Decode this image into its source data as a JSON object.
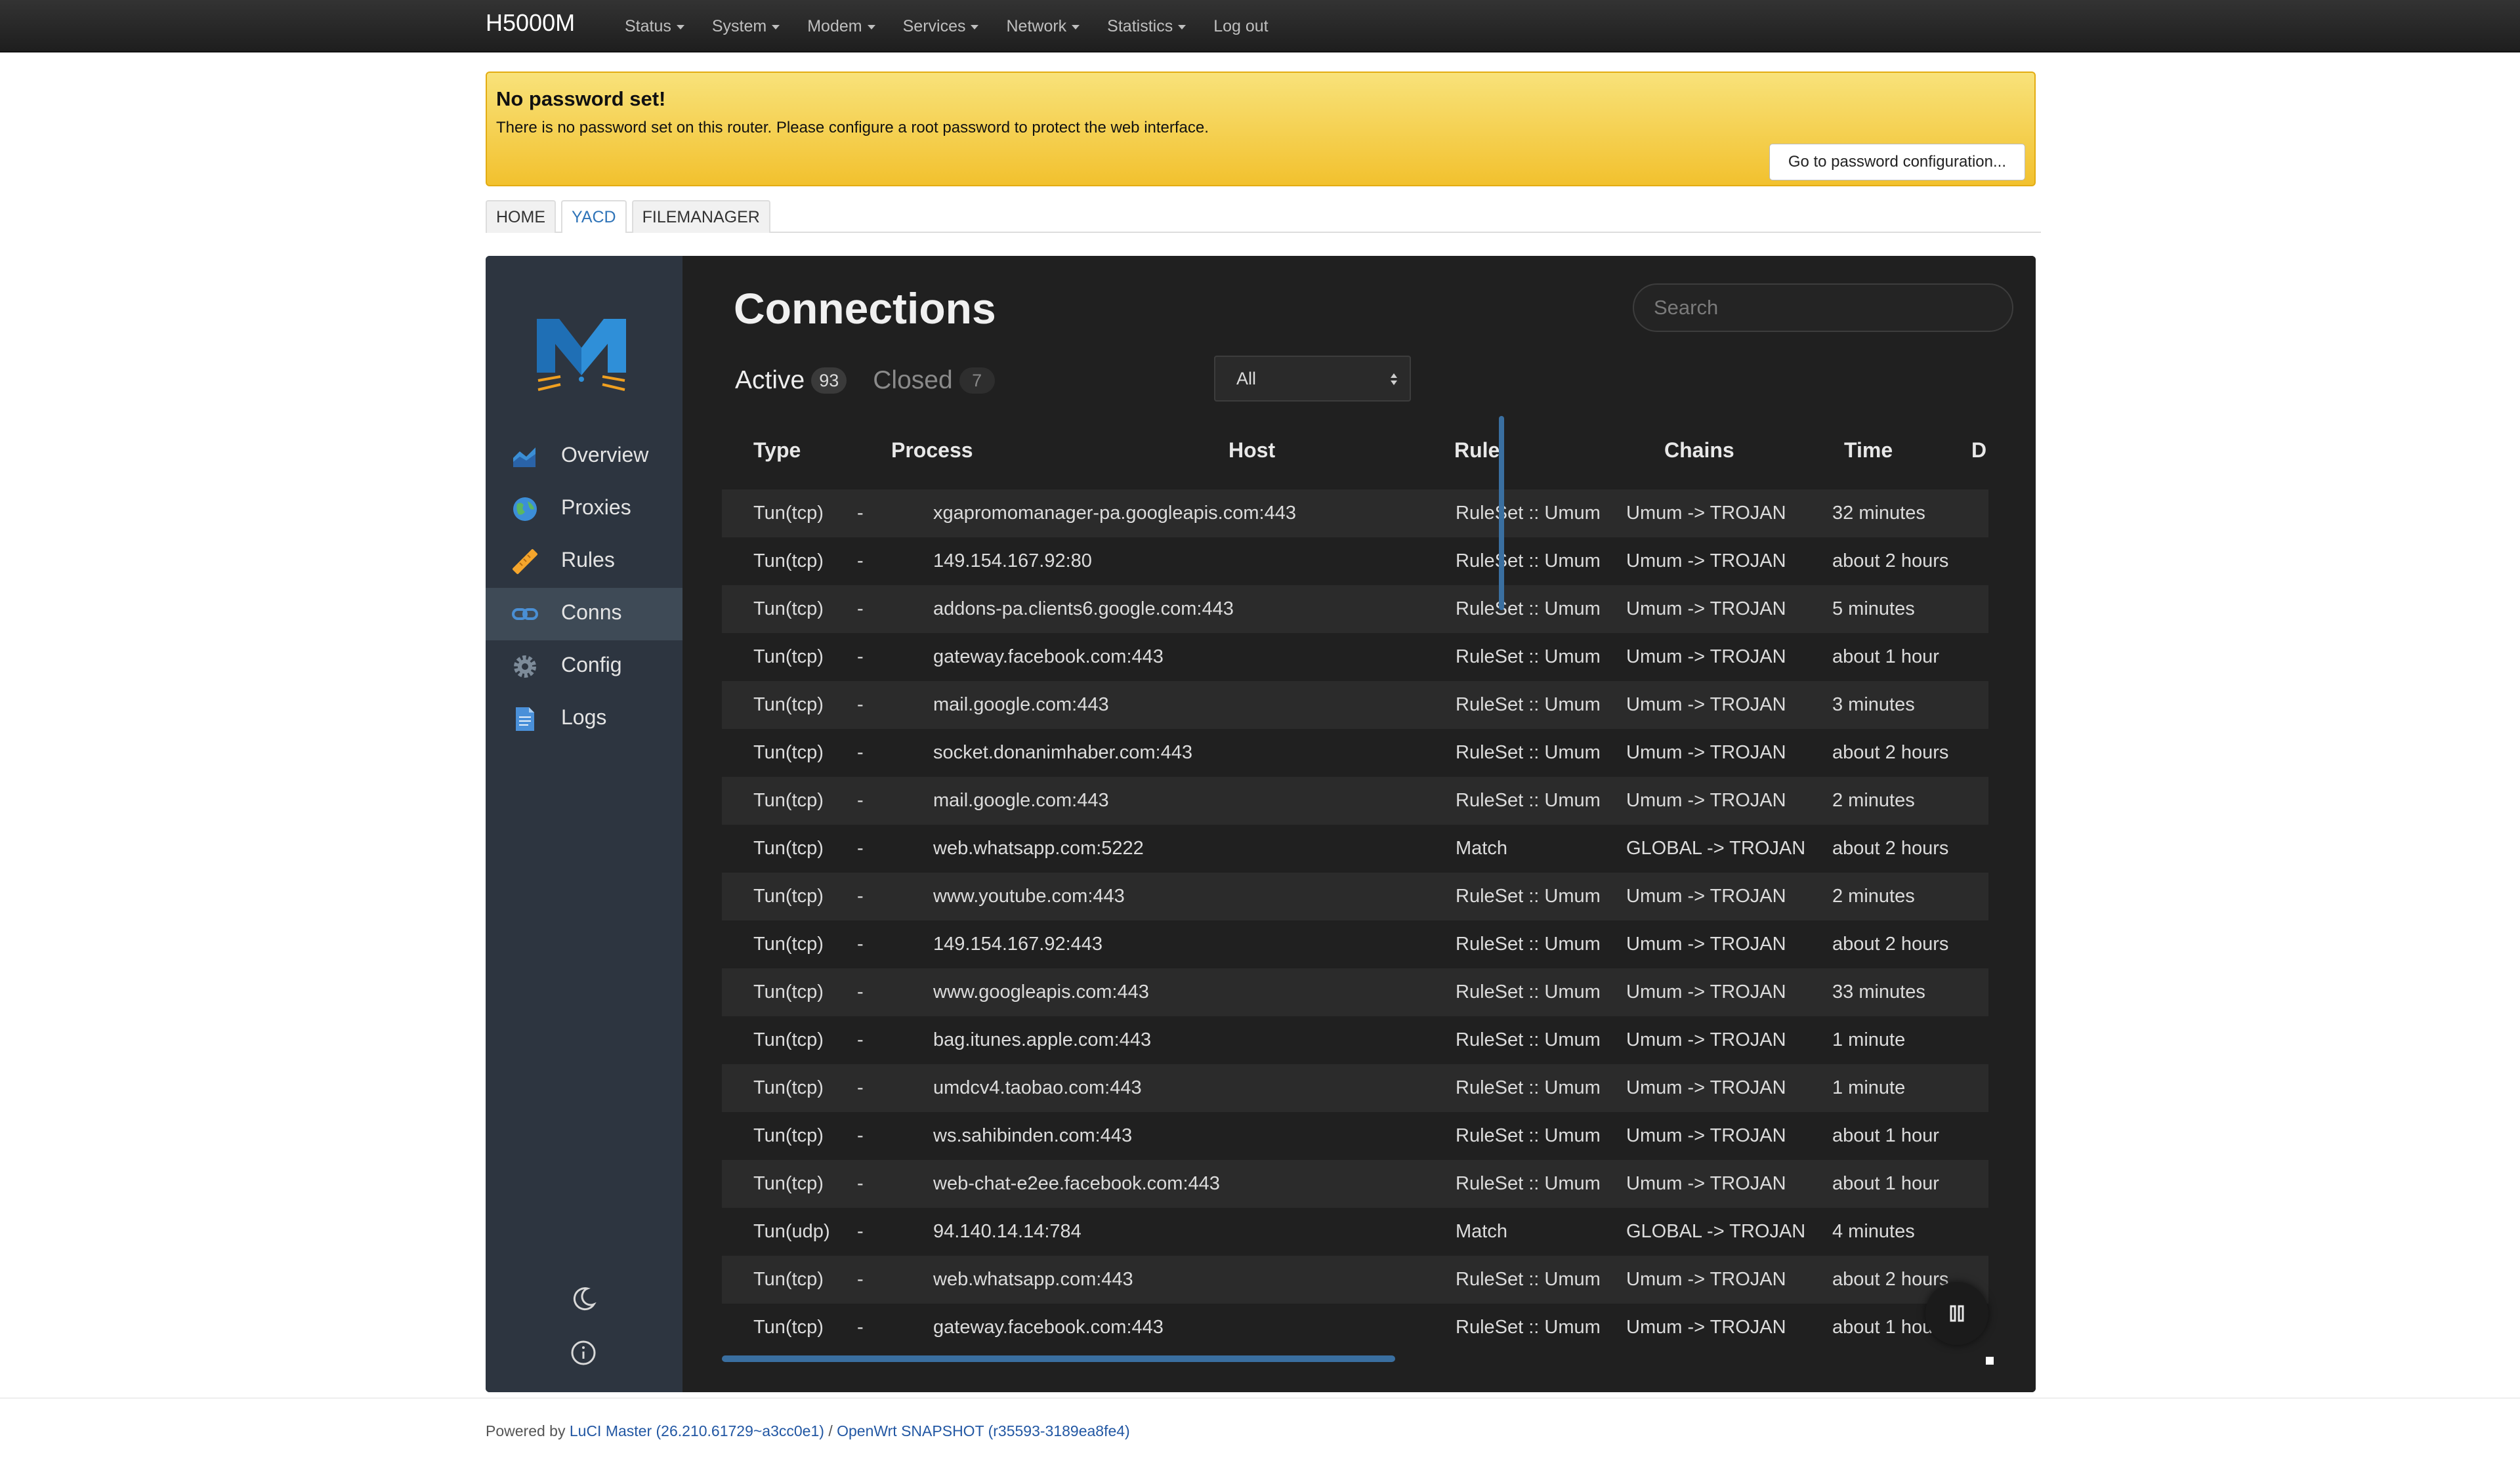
{
  "topbar": {
    "brand": "H5000M",
    "menu": [
      "Status",
      "System",
      "Modem",
      "Services",
      "Network",
      "Statistics"
    ],
    "logout": "Log out"
  },
  "alert": {
    "title": "No password set!",
    "text": "There is no password set on this router. Please configure a root password to protect the web interface.",
    "button": "Go to password configuration..."
  },
  "luci_tabs": [
    {
      "label": "HOME",
      "active": false
    },
    {
      "label": "YACD",
      "active": true
    },
    {
      "label": "FILEMANAGER",
      "active": false
    }
  ],
  "sidebar": {
    "items": [
      {
        "label": "Overview",
        "icon": "overview-chart-icon",
        "active": false
      },
      {
        "label": "Proxies",
        "icon": "globe-icon",
        "active": false
      },
      {
        "label": "Rules",
        "icon": "ruler-icon",
        "active": false
      },
      {
        "label": "Conns",
        "icon": "link-icon",
        "active": true
      },
      {
        "label": "Config",
        "icon": "gear-icon",
        "active": false
      },
      {
        "label": "Logs",
        "icon": "document-icon",
        "active": false
      }
    ],
    "bottom_icons": [
      "moon-icon",
      "info-icon"
    ]
  },
  "main": {
    "title": "Connections",
    "search_placeholder": "Search",
    "tabs": [
      {
        "label": "Active",
        "count": "93"
      },
      {
        "label": "Closed",
        "count": "7"
      }
    ],
    "filter_value": "All"
  },
  "table": {
    "headers": [
      "Type",
      "Process",
      "Host",
      "Rule",
      "Chains",
      "Time",
      "D"
    ],
    "rows": [
      [
        "Tun(tcp)",
        "-",
        "xgapromomanager-pa.googleapis.com:443",
        "RuleSet :: Umum",
        "Umum -> TROJAN",
        "32 minutes"
      ],
      [
        "Tun(tcp)",
        "-",
        "149.154.167.92:80",
        "RuleSet :: Umum",
        "Umum -> TROJAN",
        "about 2 hours"
      ],
      [
        "Tun(tcp)",
        "-",
        "addons-pa.clients6.google.com:443",
        "RuleSet :: Umum",
        "Umum -> TROJAN",
        "5 minutes"
      ],
      [
        "Tun(tcp)",
        "-",
        "gateway.facebook.com:443",
        "RuleSet :: Umum",
        "Umum -> TROJAN",
        "about 1 hour"
      ],
      [
        "Tun(tcp)",
        "-",
        "mail.google.com:443",
        "RuleSet :: Umum",
        "Umum -> TROJAN",
        "3 minutes"
      ],
      [
        "Tun(tcp)",
        "-",
        "socket.donanimhaber.com:443",
        "RuleSet :: Umum",
        "Umum -> TROJAN",
        "about 2 hours"
      ],
      [
        "Tun(tcp)",
        "-",
        "mail.google.com:443",
        "RuleSet :: Umum",
        "Umum -> TROJAN",
        "2 minutes"
      ],
      [
        "Tun(tcp)",
        "-",
        "web.whatsapp.com:5222",
        "Match",
        "GLOBAL -> TROJAN",
        "about 2 hours"
      ],
      [
        "Tun(tcp)",
        "-",
        "www.youtube.com:443",
        "RuleSet :: Umum",
        "Umum -> TROJAN",
        "2 minutes"
      ],
      [
        "Tun(tcp)",
        "-",
        "149.154.167.92:443",
        "RuleSet :: Umum",
        "Umum -> TROJAN",
        "about 2 hours"
      ],
      [
        "Tun(tcp)",
        "-",
        "www.googleapis.com:443",
        "RuleSet :: Umum",
        "Umum -> TROJAN",
        "33 minutes"
      ],
      [
        "Tun(tcp)",
        "-",
        "bag.itunes.apple.com:443",
        "RuleSet :: Umum",
        "Umum -> TROJAN",
        "1 minute"
      ],
      [
        "Tun(tcp)",
        "-",
        "umdcv4.taobao.com:443",
        "RuleSet :: Umum",
        "Umum -> TROJAN",
        "1 minute"
      ],
      [
        "Tun(tcp)",
        "-",
        "ws.sahibinden.com:443",
        "RuleSet :: Umum",
        "Umum -> TROJAN",
        "about 1 hour"
      ],
      [
        "Tun(tcp)",
        "-",
        "web-chat-e2ee.facebook.com:443",
        "RuleSet :: Umum",
        "Umum -> TROJAN",
        "about 1 hour"
      ],
      [
        "Tun(udp)",
        "-",
        "94.140.14.14:784",
        "Match",
        "GLOBAL -> TROJAN",
        "4 minutes"
      ],
      [
        "Tun(tcp)",
        "-",
        "web.whatsapp.com:443",
        "RuleSet :: Umum",
        "Umum -> TROJAN",
        "about 2 hours"
      ],
      [
        "Tun(tcp)",
        "-",
        "gateway.facebook.com:443",
        "RuleSet :: Umum",
        "Umum -> TROJAN",
        "about 1 hour"
      ]
    ]
  },
  "footer": {
    "prefix": "Powered by",
    "luci": "LuCI Master (26.210.61729~a3cc0e1)",
    "sep": "/",
    "openwrt": "OpenWrt SNAPSHOT (r35593-3189ea8fe4)"
  },
  "colors": {
    "topbar": "#222222",
    "alert": "#f2c12e",
    "panel": "#202020",
    "sidebar": "#2d3540",
    "accent": "#3a6fa0"
  }
}
